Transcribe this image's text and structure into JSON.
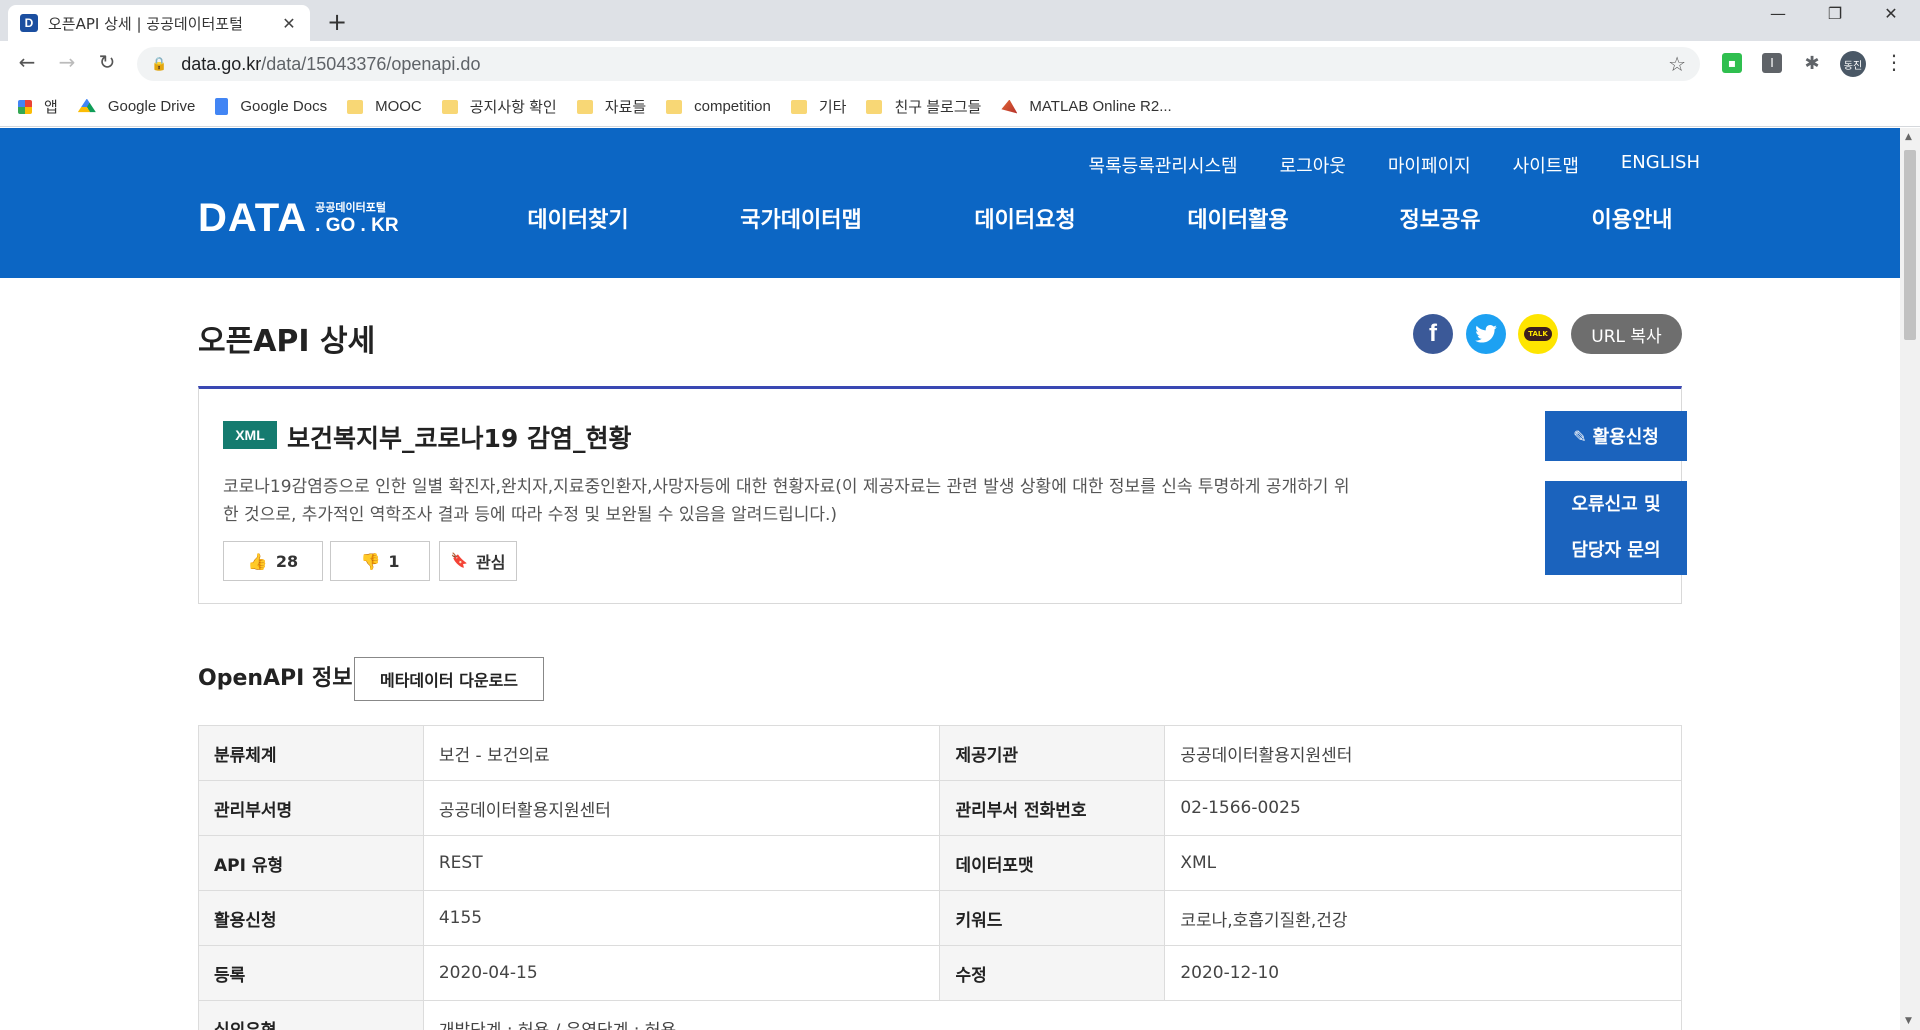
{
  "browser": {
    "tab_title": "오픈API 상세 | 공공데이터포털",
    "favicon_letter": "D",
    "url_host": "data.go.kr",
    "url_path": "/data/15043376/openapi.do",
    "profile_label": "동진",
    "bookmarks": [
      {
        "label": "앱",
        "icon": "apps-grid-icon"
      },
      {
        "label": "Google Drive",
        "icon": "google-drive-icon"
      },
      {
        "label": "Google Docs",
        "icon": "google-docs-icon"
      },
      {
        "label": "MOOC",
        "icon": "folder-icon"
      },
      {
        "label": "공지사항 확인",
        "icon": "folder-icon"
      },
      {
        "label": "자료들",
        "icon": "folder-icon"
      },
      {
        "label": "competition",
        "icon": "folder-icon"
      },
      {
        "label": "기타",
        "icon": "folder-icon"
      },
      {
        "label": "친구 블로그들",
        "icon": "folder-icon"
      },
      {
        "label": "MATLAB Online R2...",
        "icon": "matlab-icon"
      }
    ]
  },
  "header": {
    "util_links": [
      "목록등록관리시스템",
      "로그아웃",
      "마이페이지",
      "사이트맵",
      "ENGLISH"
    ],
    "logo_main": "DATA",
    "logo_sub_top": "공공데이터포털",
    "logo_sub_bottom": ". GO . KR",
    "nav": [
      "데이터찾기",
      "국가데이터맵",
      "데이터요청",
      "데이터활용",
      "정보공유",
      "이용안내"
    ]
  },
  "page": {
    "title": "오픈API 상세",
    "url_copy_label": "URL 복사",
    "kakao_label": "TALK"
  },
  "dataset": {
    "badge": "XML",
    "title": "보건복지부_코로나19 감염_현황",
    "description": "코로나19감염증으로 인한 일별 확진자,완치자,지료중인환자,사망자등에 대한 현황자료(이 제공자료는 관련 발생 상황에 대한 정보를 신속 투명하게 공개하기 위한 것으로, 추가적인 역학조사 결과 등에 따라 수정 및 보완될 수 있음을 알려드립니다.)",
    "likes": "28",
    "dislikes": "1",
    "favorite_label": "관심",
    "apply_label": "활용신청",
    "report_line1": "오류신고 및",
    "report_line2": "담당자 문의"
  },
  "openapi_info": {
    "section_title": "OpenAPI 정보",
    "metadata_download_label": "메타데이터 다운로드",
    "rows": [
      {
        "k1": "분류체계",
        "v1": "보건 - 보건의료",
        "k2": "제공기관",
        "v2": "공공데이터활용지원센터"
      },
      {
        "k1": "관리부서명",
        "v1": "공공데이터활용지원센터",
        "k2": "관리부서 전화번호",
        "v2": "02-1566-0025"
      },
      {
        "k1": "API 유형",
        "v1": "REST",
        "k2": "데이터포맷",
        "v2": "XML"
      },
      {
        "k1": "활용신청",
        "v1": "4155",
        "k2": "키워드",
        "v2": "코로나,호흡기질환,건강"
      },
      {
        "k1": "등록",
        "v1": "2020-04-15",
        "k2": "수정",
        "v2": "2020-12-10"
      },
      {
        "k1": "심의유형",
        "v1": "개발단계 : 허용 / 운영단계 : 허용"
      }
    ]
  }
}
